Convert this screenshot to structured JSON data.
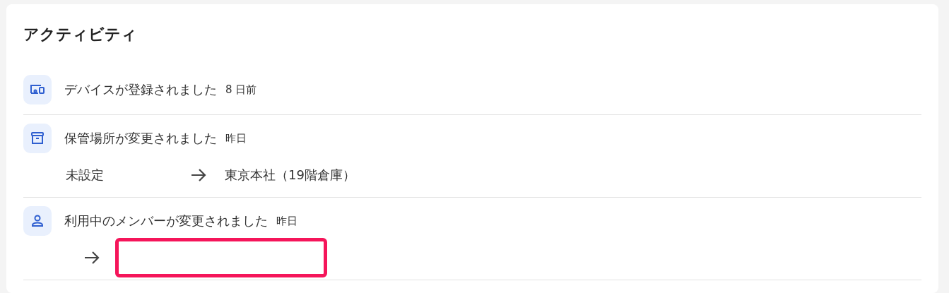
{
  "card": {
    "title": "アクティビティ"
  },
  "activities": [
    {
      "kind": "event",
      "title": "デバイスが登録されました",
      "time": "8 日前"
    },
    {
      "kind": "change",
      "title": "保管場所が変更されました",
      "time": "昨日",
      "from": "未設定",
      "to": "東京本社（19階倉庫）"
    },
    {
      "kind": "change",
      "title": "利用中のメンバーが変更されました",
      "time": "昨日",
      "highlighted": true
    }
  ]
}
